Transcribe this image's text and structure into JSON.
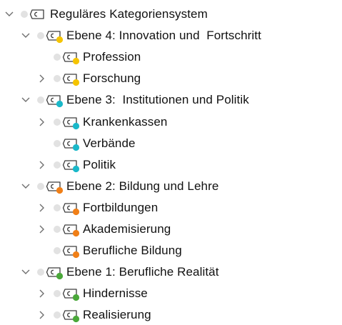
{
  "tree": {
    "root": {
      "label": "Reguläres Kategoriensystem",
      "expanded": true
    },
    "groups": [
      {
        "label": "Ebene 4: Innovation und  Fortschritt",
        "color": "#f5c400",
        "expanded": true,
        "children": [
          {
            "label": "Profession",
            "expandable": false
          },
          {
            "label": "Forschung",
            "expandable": true
          }
        ]
      },
      {
        "label": "Ebene 3:  Institutionen und Politik",
        "color": "#1ab8c9",
        "expanded": true,
        "children": [
          {
            "label": "Krankenkassen",
            "expandable": true
          },
          {
            "label": "Verbände",
            "expandable": false
          },
          {
            "label": "Politik",
            "expandable": true
          }
        ]
      },
      {
        "label": "Ebene 2: Bildung und Lehre",
        "color": "#f07f17",
        "expanded": true,
        "children": [
          {
            "label": "Fortbildungen",
            "expandable": true
          },
          {
            "label": "Akademisierung",
            "expandable": true
          },
          {
            "label": "Berufliche Bildung",
            "expandable": false
          }
        ]
      },
      {
        "label": "Ebene 1: Berufliche Realität",
        "color": "#4aa83a",
        "expanded": true,
        "children": [
          {
            "label": "Hindernisse",
            "expandable": true
          },
          {
            "label": "Realisierung",
            "expandable": true
          }
        ]
      }
    ]
  },
  "icons": {
    "expand": "chevron-down-icon",
    "collapse": "chevron-right-icon",
    "code": "code-icon",
    "status": "status-dot-icon"
  }
}
